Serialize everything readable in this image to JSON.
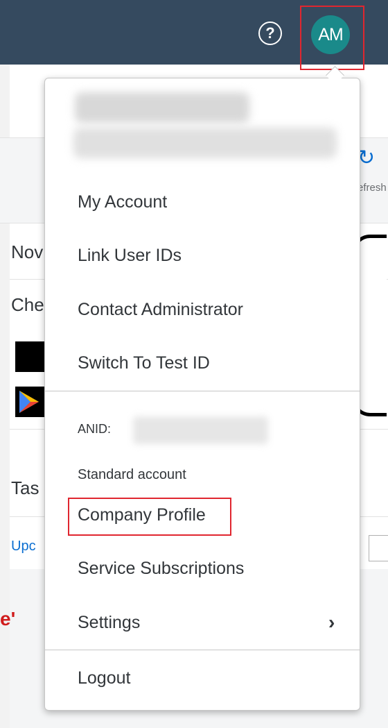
{
  "header": {
    "help_icon_glyph": "?",
    "avatar_initials": "AM",
    "avatar_color": "#1a8a8a",
    "bar_color": "#354a5f"
  },
  "background": {
    "refresh_text": "efresh",
    "fragments": [
      "Nov",
      "Che",
      "Tas",
      "Upc"
    ],
    "red_text": "e'"
  },
  "menu": {
    "items": [
      {
        "label": "My Account"
      },
      {
        "label": "Link User IDs"
      },
      {
        "label": "Contact Administrator"
      },
      {
        "label": "Switch To Test ID"
      }
    ],
    "anid_label": "ANID:",
    "account_type": "Standard account",
    "company_profile": "Company Profile",
    "service_subscriptions": "Service Subscriptions",
    "settings": "Settings",
    "settings_chevron": "›",
    "logout": "Logout"
  },
  "highlight_color": "#e0262f"
}
